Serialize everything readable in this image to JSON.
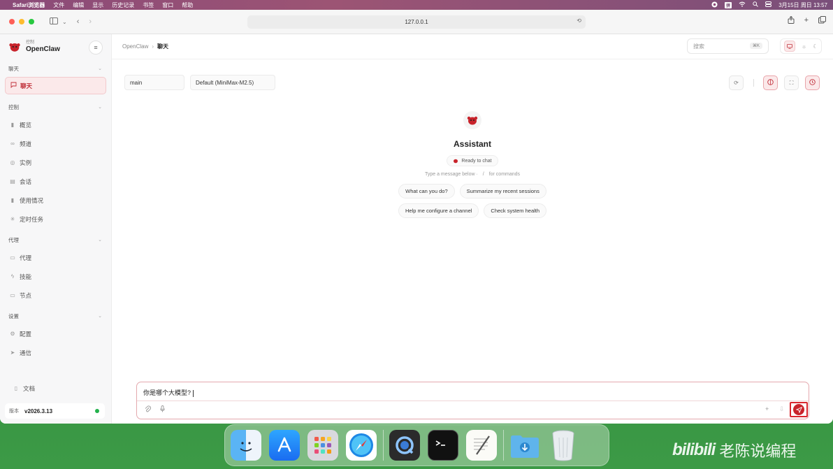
{
  "menubar": {
    "app_name": "Safari浏览器",
    "menus": [
      "文件",
      "编辑",
      "显示",
      "历史记录",
      "书签",
      "窗口",
      "帮助"
    ],
    "ime_label": "拼",
    "datetime": "3月15日 周日  13:57"
  },
  "browser": {
    "url": "127.0.0.1"
  },
  "sidebar": {
    "brand_sub": "控制",
    "brand_name": "OpenClaw",
    "sections": [
      {
        "title": "聊天",
        "items": [
          {
            "label": "聊天",
            "icon": "chat-icon"
          }
        ]
      },
      {
        "title": "控制",
        "items": [
          {
            "label": "概览",
            "icon": "bar-chart-icon"
          },
          {
            "label": "频道",
            "icon": "link-icon"
          },
          {
            "label": "实例",
            "icon": "radio-icon"
          },
          {
            "label": "会话",
            "icon": "document-icon"
          },
          {
            "label": "使用情况",
            "icon": "bar-chart-icon"
          },
          {
            "label": "定时任务",
            "icon": "clock-loader-icon"
          }
        ]
      },
      {
        "title": "代理",
        "items": [
          {
            "label": "代理",
            "icon": "folder-icon"
          },
          {
            "label": "技能",
            "icon": "lightning-icon"
          },
          {
            "label": "节点",
            "icon": "monitor-icon"
          }
        ]
      },
      {
        "title": "设置",
        "items": [
          {
            "label": "配置",
            "icon": "gear-icon"
          },
          {
            "label": "通信",
            "icon": "send-icon"
          }
        ]
      }
    ],
    "docs_label": "文档",
    "version_label": "版本",
    "version_value": "v2026.3.13"
  },
  "topbar": {
    "breadcrumb_root": "OpenClaw",
    "breadcrumb_current": "聊天",
    "search_placeholder": "搜索",
    "search_shortcut": "⌘K"
  },
  "chat": {
    "session_value": "main",
    "model_value": "Default (MiniMax-M2.5)",
    "assistant_name": "Assistant",
    "status": "Ready to chat",
    "hint_prefix": "Type a message below ·",
    "hint_slash": "/",
    "hint_suffix": "for commands",
    "suggestions": [
      [
        "What can you do?",
        "Summarize my recent sessions"
      ],
      [
        "Help me configure a channel",
        "Check system health"
      ]
    ],
    "input_value": "你是哪个大模型?"
  },
  "colors": {
    "accent": "#c8232b",
    "active_bg": "#fbe9ea",
    "status_green": "#22b14c"
  },
  "dock": {
    "apps": [
      "finder-icon",
      "app-store-icon",
      "launchpad-icon",
      "safari-icon",
      "quicktime-icon",
      "terminal-icon",
      "textedit-icon",
      "downloads-folder-icon",
      "trash-icon"
    ]
  },
  "watermark": {
    "brand": "bilibili",
    "text": "老陈说编程"
  }
}
